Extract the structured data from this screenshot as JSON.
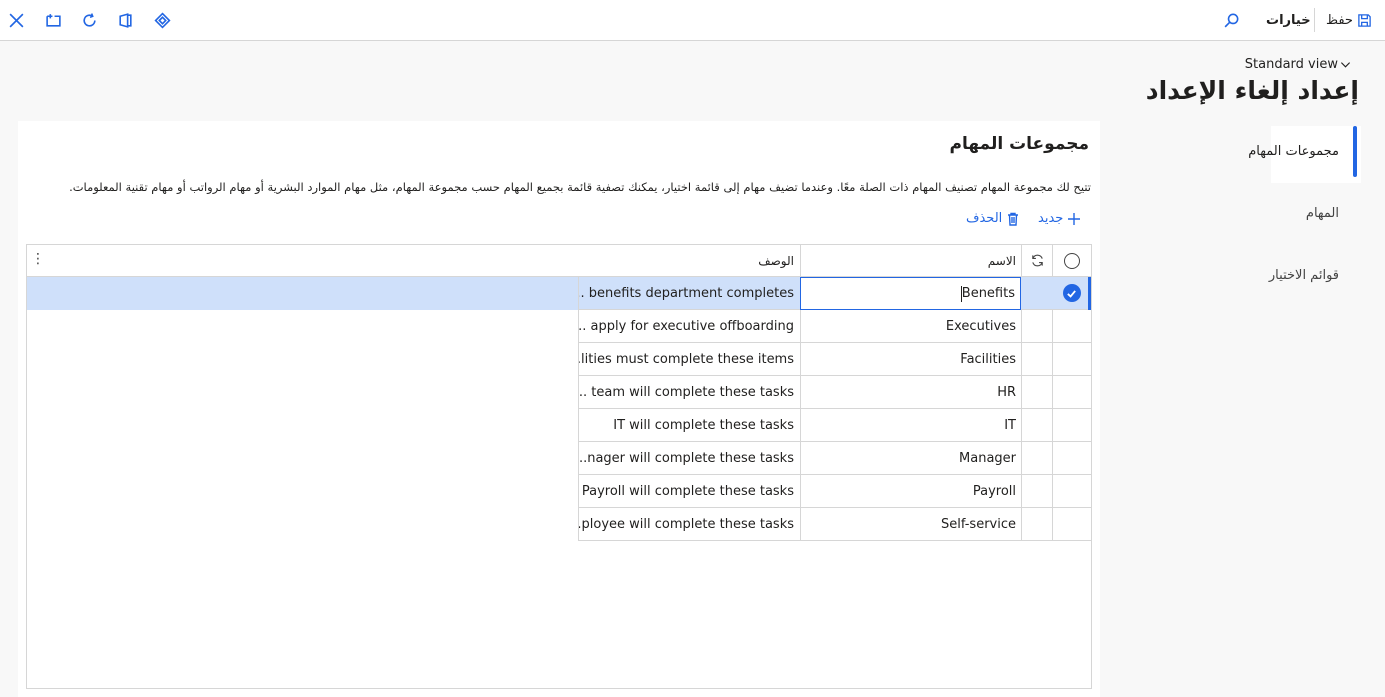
{
  "toolbar": {
    "save_label": "حفظ",
    "options_label": "خيارات",
    "left_icons": [
      "close-icon",
      "open-in-new-icon",
      "refresh-icon",
      "office-icon",
      "power-apps-icon"
    ],
    "right_icons": [
      "save-icon",
      "search-icon"
    ]
  },
  "header": {
    "view_name": "Standard view",
    "title": "إعداد إلغاء الإعداد"
  },
  "nav": {
    "items": [
      {
        "label": "مجموعات المهام",
        "active": true
      },
      {
        "label": "المهام",
        "active": false
      },
      {
        "label": "قوائم الاختيار",
        "active": false
      }
    ]
  },
  "section": {
    "title": "مجموعات المهام",
    "description": "تتيح لك مجموعة المهام تصنيف المهام ذات الصلة معًا. وعندما تضيف مهام إلى قائمة اختيار، يمكنك تصفية قائمة بجميع المهام حسب مجموعة المهام، مثل مهام الموارد البشرية أو مهام الرواتب أو مهام تقنية المعلومات.",
    "new_label": "جديد",
    "delete_label": "الحذف"
  },
  "grid": {
    "columns": {
      "name": "الاسم",
      "description": "الوصف"
    },
    "rows": [
      {
        "name": "Benefits",
        "description": "... benefits department completes",
        "selected": true
      },
      {
        "name": "Executives",
        "description": "... apply for executive offboarding",
        "selected": false
      },
      {
        "name": "Facilities",
        "description": "...lities must complete these items",
        "selected": false
      },
      {
        "name": "HR",
        "description": "... team will complete these tasks",
        "selected": false
      },
      {
        "name": "IT",
        "description": "IT will complete these tasks",
        "selected": false
      },
      {
        "name": "Manager",
        "description": "...nager will complete these tasks",
        "selected": false
      },
      {
        "name": "Payroll",
        "description": "Payroll will complete these tasks",
        "selected": false
      },
      {
        "name": "Self-service",
        "description": "...ployee will complete these tasks",
        "selected": false
      }
    ]
  },
  "colors": {
    "accent": "#2266e3",
    "selected_row": "#cfe0fa",
    "border": "#d6d6d6"
  }
}
